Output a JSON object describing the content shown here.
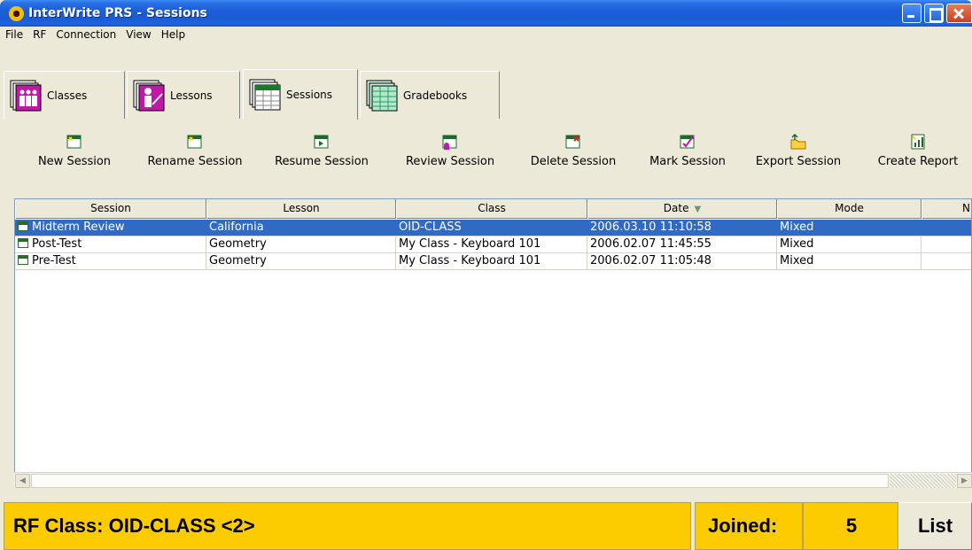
{
  "window": {
    "title": "InterWrite PRS - Sessions"
  },
  "menu": [
    "File",
    "RF",
    "Connection",
    "View",
    "Help"
  ],
  "tabs": [
    {
      "label": "Classes",
      "icon": "classes-icon",
      "active": false
    },
    {
      "label": "Lessons",
      "icon": "lessons-icon",
      "active": false
    },
    {
      "label": "Sessions",
      "icon": "sessions-icon",
      "active": true
    },
    {
      "label": "Gradebooks",
      "icon": "gradebooks-icon",
      "active": false
    }
  ],
  "toolbar": [
    {
      "label": "New Session",
      "icon": "new-session-icon"
    },
    {
      "label": "Rename Session",
      "icon": "rename-session-icon"
    },
    {
      "label": "Resume Session",
      "icon": "resume-session-icon"
    },
    {
      "label": "Review Session",
      "icon": "review-session-icon"
    },
    {
      "label": "Delete Session",
      "icon": "delete-session-icon"
    },
    {
      "label": "Mark Session",
      "icon": "mark-session-icon"
    },
    {
      "label": "Export Session",
      "icon": "export-session-icon"
    },
    {
      "label": "Create Report",
      "icon": "create-report-icon"
    }
  ],
  "table": {
    "columns": [
      "Session",
      "Lesson",
      "Class",
      "Date",
      "Mode",
      "N"
    ],
    "sort_column": "Date",
    "sort_direction": "descending",
    "rows": [
      {
        "session": "Midterm Review",
        "lesson": "California",
        "class": "OID-CLASS",
        "date": "2006.03.10 11:10:58",
        "mode": "Mixed",
        "selected": true
      },
      {
        "session": "Post-Test",
        "lesson": "Geometry",
        "class": "My Class - Keyboard 101",
        "date": "2006.02.07 11:45:55",
        "mode": "Mixed",
        "selected": false
      },
      {
        "session": "Pre-Test",
        "lesson": "Geometry",
        "class": "My Class - Keyboard 101",
        "date": "2006.02.07 11:05:48",
        "mode": "Mixed",
        "selected": false
      }
    ]
  },
  "status": {
    "rf_class": "RF Class: OID-CLASS <2>",
    "joined_label": "Joined:",
    "joined_count": "5",
    "list_label": "List",
    "accent_color": "#fccc00"
  },
  "colors": {
    "selection": "#316ac5",
    "titlebar": "#1b5ed8"
  }
}
